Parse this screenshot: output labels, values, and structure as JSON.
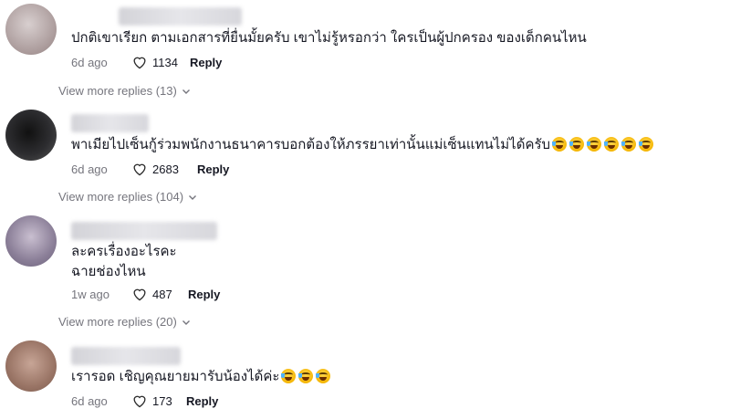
{
  "comments": [
    {
      "lines": [
        "ปกติเขาเรียก ตามเอกสารที่ยื่นมั้ยครับ เขาไม่รู้หรอกว่า ใครเป็นผู้ปกครอง ของเด็กคนไหน"
      ],
      "date": "6d ago",
      "likes": "1134",
      "reply_label": "Reply",
      "view_more": "View more replies (13)",
      "avatar_color": "#b8a9a9"
    },
    {
      "lines": [
        "พาเมียไปเซ็นกู้ร่วมพนักงานธนาคารบอกต้องให้ภรรยาเท่านั้นแม่เซ็นแทนไม่ได้ครับ"
      ],
      "emoji": [
        "laughing-crying-emoji",
        "laughing-crying-emoji",
        "laughing-crying-emoji",
        "laughing-crying-emoji",
        "laughing-crying-emoji",
        "laughing-crying-emoji"
      ],
      "date": "6d ago",
      "likes": "2683",
      "reply_label": "Reply",
      "view_more": "View more replies (104)",
      "avatar_color": "#2b2b2e"
    },
    {
      "lines": [
        "ละครเรื่องอะไรคะ",
        "ฉายช่องไหน"
      ],
      "date": "1w ago",
      "likes": "487",
      "reply_label": "Reply",
      "view_more": "View more replies (20)",
      "avatar_color": "#8a8195"
    },
    {
      "lines": [
        "เรารอด เชิญคุณยายมารับน้องได้ค่ะ"
      ],
      "emoji": [
        "laughing-crying-emoji",
        "laughing-crying-emoji",
        "laughing-crying-emoji"
      ],
      "date": "6d ago",
      "likes": "173",
      "reply_label": "Reply",
      "avatar_color": "#a07a6a"
    }
  ],
  "colors": {
    "text": "#161823",
    "muted": "#75757d"
  }
}
